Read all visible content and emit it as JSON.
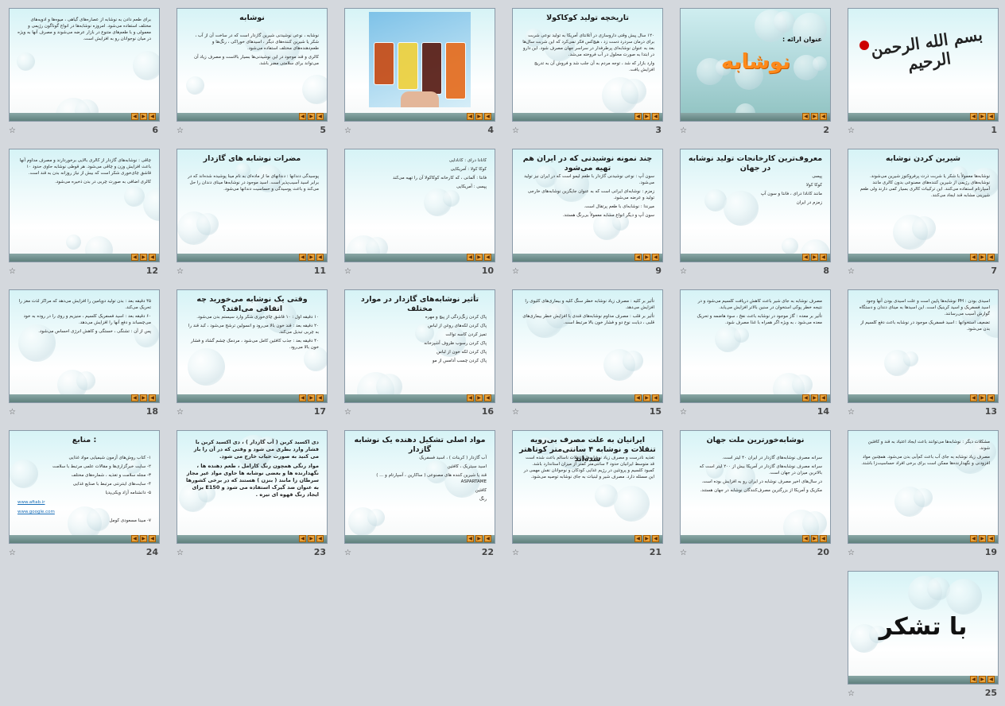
{
  "nav_glyphs": [
    "◀",
    "▶"
  ],
  "star_glyph": "☆",
  "slides": [
    {
      "num": "1",
      "title": "",
      "body": [],
      "special": "calligraphy",
      "calligraphy_text": "بسم الله الرحمن الرحیم"
    },
    {
      "num": "2",
      "title": "",
      "body": [],
      "special": "title-slide",
      "label": "عنوان ارائه :",
      "big": "نوشابه"
    },
    {
      "num": "3",
      "title": "تاریخچه تولید کوکاکولا",
      "body": [
        "۱۲۰ سال پیش وقتی داروسازی در آتلانتای آمریکا به تولید نوعی شربت برای درمان سردرد دست زد ، هیچ‌کس فکر نمی‌کرد که این شربت سال‌ها بعد به عنوان نوشابه‌ای پرطرفدار در سراسر جهان مصرف شود. این دارو در ابتدا به صورت محلول در آب فروخته می‌شد.",
        "وارد بازار که شد ، توجه مردم به آن جلب شد و فروش آن به تدریج افزایش یافت."
      ]
    },
    {
      "num": "4",
      "title": "",
      "body": [],
      "special": "photo"
    },
    {
      "num": "5",
      "title": "نوشابه",
      "body": [
        "نوشابه ، نوعی نوشیدنی شیرین گازدار است که در ساخت آن از آب ، شکر یا شیرین کننده‌های دیگر ، اسیدهای خوراکی ، رنگ‌ها و طعم‌دهنده‌های مختلف استفاده می‌شود.",
        "کالری و قند موجود در این نوشیدنی‌ها بسیار بالاست و مصرف زیاد آن می‌تواند برای سلامتی مضر باشد."
      ]
    },
    {
      "num": "6",
      "title": "",
      "body": [
        "برای طعم دادن به نوشابه از عصاره‌های گیاهی ، میوه‌ها و ادویه‌های مختلف استفاده می‌شود. امروزه نوشابه‌ها در انواع گوناگون رژیمی و معمولی و با طعم‌های متنوع در بازار عرضه می‌شوند و مصرف آنها به ویژه در میان نوجوانان رو به افزایش است."
      ]
    },
    {
      "num": "7",
      "title": "شیرین کردن نوشابه",
      "body": [
        "نوشابه‌ها معمولاً با شکر یا شربت ذرت پرفروکتوز شیرین می‌شوند. نوشابه‌های رژیمی از شیرین کننده‌های مصنوعی بدون کالری مانند آسپارتام استفاده می‌کنند. این ترکیبات کالری بسیار کمی دارند ولی طعم شیرینی مشابه قند ایجاد می‌کنند."
      ]
    },
    {
      "num": "8",
      "title": "معروف‌ترین کارخانجات تولید نوشابه در جهان",
      "body": [
        "پپسی",
        "کوکا کولا",
        "مانند کانادا درای ، فانتا و سون آپ",
        "زمزم در ایران"
      ]
    },
    {
      "num": "9",
      "title": "چند نمونه نوشیدنی که در ایران هم تهیه می‌شود",
      "body": [
        "سون آپ : نوعی نوشیدنی گازدار با طعم لیمو است که در ایران نیز تولید می‌شود.",
        "زمزم : نوشابه‌ای ایرانی است که به عنوان جایگزین نوشابه‌های خارجی تولید و عرضه می‌شود.",
        "میرندا : نوشابه‌ای با طعم پرتقال است.",
        "سون آپ و دیگر انواع مشابه معمولاً بی‌رنگ هستند."
      ]
    },
    {
      "num": "10",
      "title": "",
      "body": [
        "کانادا درای : کانادایی",
        "کوکا کولا : آمریکایی",
        "فانتا : آلمانی ، که کارخانه کوکاکولا آن را تهیه می‌کند",
        "پپسی : آمریکایی"
      ]
    },
    {
      "num": "11",
      "title": "مضرات نوشابه های گازدار",
      "body": [
        "پوسیدگی دندانها : دندانهای ما از ماده‌ای به نام مینا پوشیده شده‌اند که در برابر اسید آسیب‌پذیر است. اسید موجود در نوشابه‌ها مینای دندان را حل می‌کند و باعث پوسیدگی و حساسیت دندانها می‌شود."
      ]
    },
    {
      "num": "12",
      "title": "",
      "body": [
        "چاقی : نوشابه‌های گازدار از کالری بالایی برخوردارند و مصرف مداوم آنها باعث افزایش وزن و چاقی می‌شود. هر قوطی نوشابه حاوی حدود ۱۰ قاشق چای‌خوری شکر است که بیش از نیاز روزانه بدن به قند است.",
        "کالری اضافی به صورت چربی در بدن ذخیره می‌شود."
      ]
    },
    {
      "num": "13",
      "title": "",
      "body": [
        "اسیدی بودن : PH نوشابه‌ها پایین است و علت اسیدی بودن آنها وجود اسید فسفریک و اسید کربنیک است. این اسیدها به مینای دندان و دستگاه گوارش آسیب می‌رسانند.",
        "تضعیف استخوانها : اسید فسفریک موجود در نوشابه باعث دفع کلسیم از بدن می‌شود."
      ]
    },
    {
      "num": "14",
      "title": "",
      "body": [
        "مصرف نوشابه به جای شیر باعث کاهش دریافت کلسیم می‌شود و در نتیجه خطر پوکی استخوان در سنین بالاتر افزایش می‌یابد.",
        "تأثیر بر معده : گاز موجود در نوشابه باعث نفخ ، سوء هاضمه و تحریک معده می‌شود ، به ویژه اگر همراه با غذا مصرف شود."
      ]
    },
    {
      "num": "15",
      "title": "",
      "body": [
        "تأثیر بر کلیه : مصرف زیاد نوشابه خطر سنگ کلیه و بیماری‌های کلیوی را افزایش می‌دهد.",
        "تأثیر بر قلب : مصرف مداوم نوشابه‌های قندی با افزایش خطر بیماری‌های قلبی ، دیابت نوع دو و فشار خون بالا مرتبط است."
      ]
    },
    {
      "num": "16",
      "title": "تأثیر نوشابه‌های گازدار در موارد مختلف",
      "body": [
        "پاک کردن زنگ‌زدگی از پیچ و مهره",
        "پاک کردن لکه‌های روغن از لباس",
        "تمیز کردن کاسه توالت",
        "پاک کردن رسوب ظروف آشپزخانه",
        "پاک کردن لکه خون از لباس",
        "پاک کردن چسب آدامس از مو"
      ]
    },
    {
      "num": "17",
      "title": "وقتی یک نوشابه می‌خورید چه اتفاقی می‌افتد؟",
      "body": [
        "۱۰ دقیقه اول : ۱۰ قاشق چای‌خوری شکر وارد سیستم بدن می‌شود.",
        "۲۰ دقیقه بعد : قند خون بالا می‌رود و انسولین ترشح می‌شود ، کبد قند را به چربی تبدیل می‌کند.",
        "۴۰ دقیقه بعد : جذب کافئین کامل می‌شود ، مردمک چشم گشاد و فشار خون بالا می‌رود."
      ]
    },
    {
      "num": "18",
      "title": "",
      "body": [
        "۴۵ دقیقه بعد : بدن تولید دوپامین را افزایش می‌دهد که مراکز لذت مغز را تحریک می‌کند.",
        "۶۰ دقیقه بعد : اسید فسفریک کلسیم ، منیزیم و روی را در روده به خود می‌چسباند و دفع آنها را افزایش می‌دهد.",
        "پس از آن : تشنگی ، خستگی و کاهش انرژی احساس می‌شود."
      ]
    },
    {
      "num": "19",
      "title": "",
      "body": [
        "مشکلات دیگر : نوشابه‌ها می‌توانند باعث ایجاد اعتیاد به قند و کافئین شوند.",
        "مصرف زیاد نوشابه به جای آب باعث کم‌آبی بدن می‌شود. همچنین مواد افزودنی و نگهدارنده‌ها ممکن است برای برخی افراد حساسیت‌زا باشند."
      ]
    },
    {
      "num": "20",
      "title": "نوشابه‌خورترین ملت جهان",
      "body": [
        "سرانه مصرف نوشابه‌های گازدار در ایران ۴۰ لیتر است.",
        "سرانه مصرف نوشابه‌های گازدار در آمریکا بیش از ۲۰۰ لیتر است که بالاترین میزان در جهان است.",
        "در سال‌های اخیر مصرف نوشابه در ایران رو به افزایش بوده است.",
        "مکزیک و آمریکا از بزرگترین مصرف‌کنندگان نوشابه در جهان هستند."
      ]
    },
    {
      "num": "21",
      "title": "ایرانیان به علت مصرف بی‌رویه تنقلات و نوشابه ۴ سانتی‌متر کوتاهتر شده‌اند",
      "body": [
        "تغذیه نادرست و مصرف زیاد نوشابه‌ها و تنقلات ناسالم باعث شده است قد متوسط ایرانیان حدود ۴ سانتی‌متر کمتر از میزان استاندارد باشد. کمبود کلسیم و پروتئین در رژیم غذایی کودکان و نوجوانان نقش مهمی در این مسئله دارد. مصرف شیر و لبنیات به جای نوشابه توصیه می‌شود."
      ]
    },
    {
      "num": "22",
      "title": "مواد اصلی تشکیل دهنده یک نوشابه گازدار",
      "body": [
        "آب گازدار ( کربنات ) ، اسید فسفریک",
        "اسید سیتریک ، کافئین",
        "قند یا شیرین کننده های مصنوعی ( ساکارین ، آسپارتام و ... ) ASPARTAME",
        "کافئین",
        "رنگ"
      ]
    },
    {
      "num": "23",
      "title": "",
      "body": [
        "دی اکسید کربن ( آب گازدار ) ، دی اکسید کربن با فشار وارد بطری می شود و وقتی که در آن را باز می کنید به صورت حباب خارج می شود.",
        "مواد رنگی همچون رنگ کارامل ، طعم دهنده ها ، نگهدارنده ها و بعضی نوشابه ها حاوی مواد غیر مجاز سرطان زا مانند ( بنزن ) هستند که در برخی کشورها به عنوان ضد گیرک استفاده می شود و E150 برای ایجاد رنگ قهوه ای تیره ."
      ]
    },
    {
      "num": "24",
      "title": "منابع :",
      "body": [
        "۱- کتاب روش‌های آزمون شیمیایی مواد غذایی",
        "۲- سایت خبرگزاری‌ها و مقالات علمی مرتبط با سلامت",
        "۳- مجله سلامت و تغذیه ، شماره‌های مختلف",
        "۴- سایت‌های اینترنتی مرتبط با صنایع غذایی",
        "۵- دانشنامه آزاد ویکی‌پدیا"
      ],
      "links": [
        "www.aftab.ir",
        "www.google.com"
      ],
      "author": "۷- مبینا  مسعودی کومل"
    },
    {
      "num": "25",
      "title": "",
      "body": [],
      "special": "thanks",
      "big": "با تشکر"
    }
  ]
}
